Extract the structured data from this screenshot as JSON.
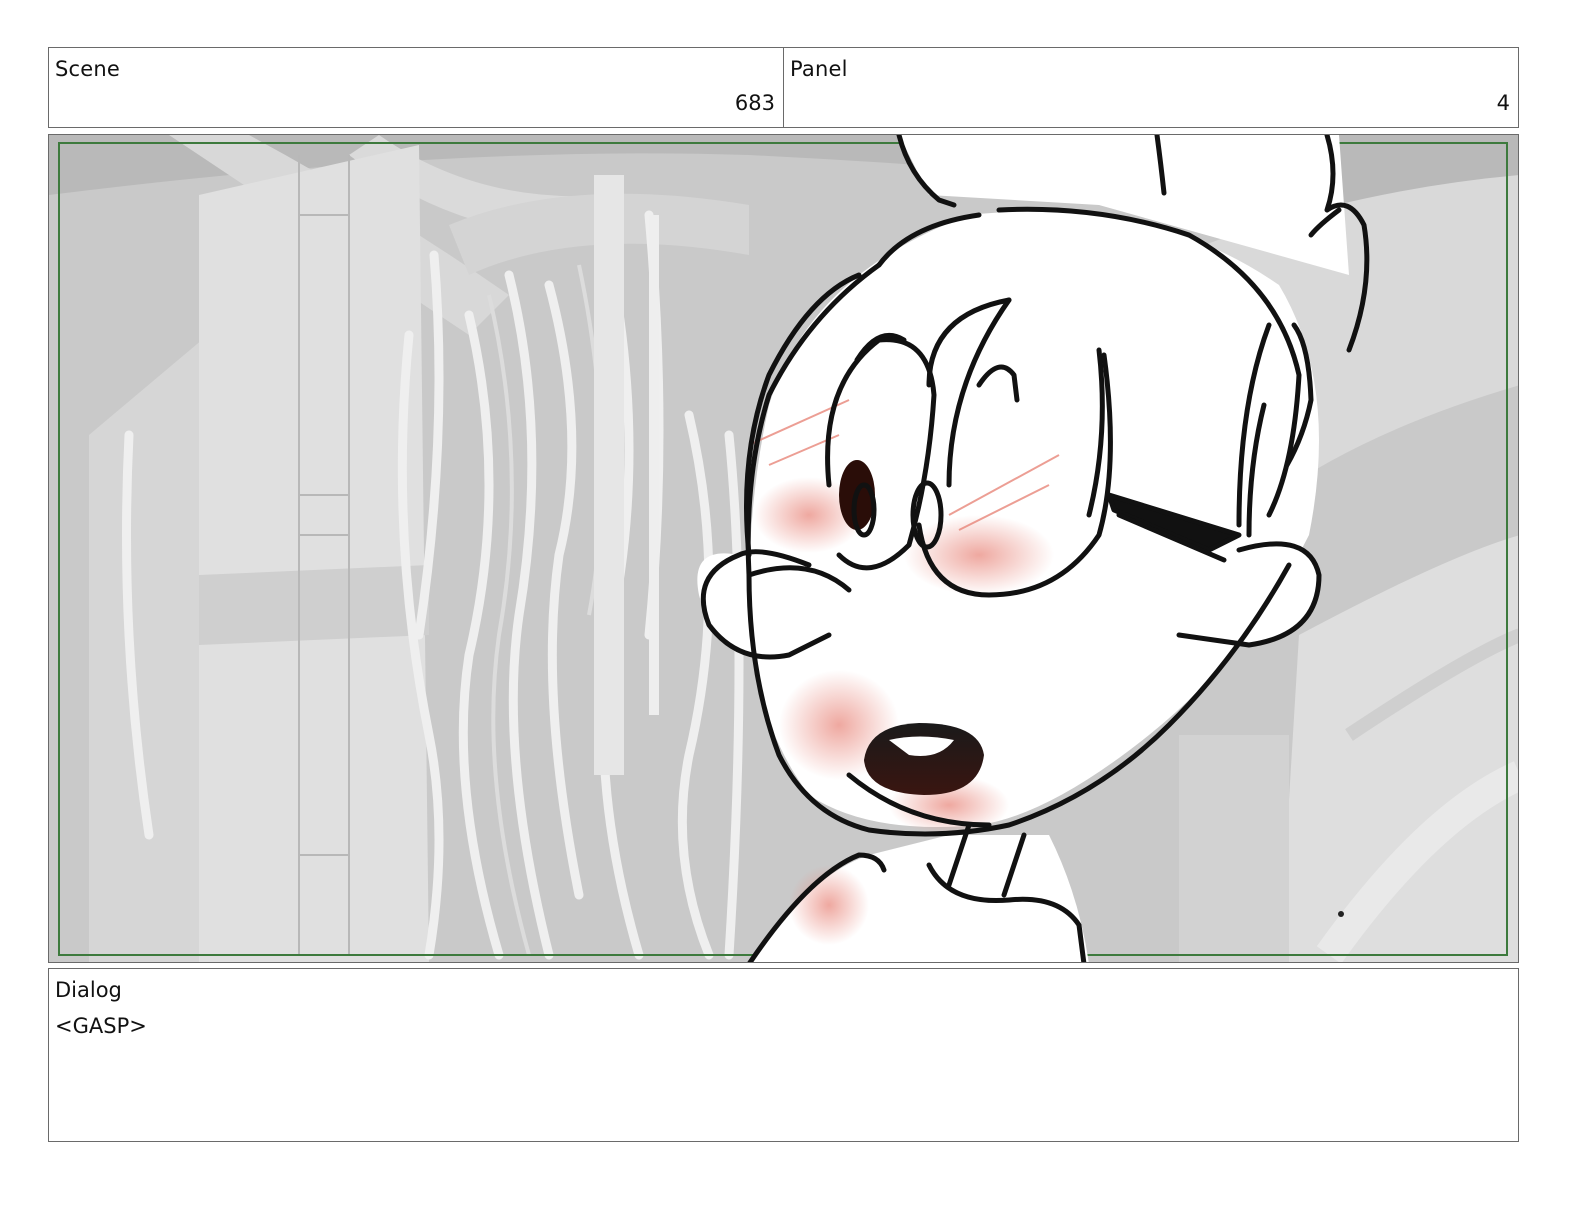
{
  "header": {
    "scene_label": "Scene",
    "scene_value": "683",
    "panel_label": "Panel",
    "panel_value": "4"
  },
  "frame": {
    "description_icon": "storyboard-drawing",
    "safe_area_color": "#3d7a3d",
    "background_color": "#c8c8c8",
    "blush_color": "#f3b4ab"
  },
  "dialog": {
    "label": "Dialog",
    "text": "<GASP>"
  }
}
